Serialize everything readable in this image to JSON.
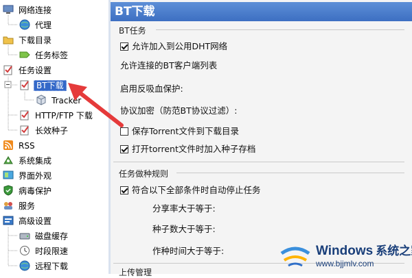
{
  "sidebar": {
    "items": [
      {
        "label": "网络连接",
        "icon": "network-icon"
      },
      {
        "label": "代理",
        "icon": "globe-icon"
      },
      {
        "label": "下载目录",
        "icon": "folder-icon"
      },
      {
        "label": "任务标签",
        "icon": "tag-icon"
      },
      {
        "label": "任务设置",
        "icon": "task-settings-icon"
      },
      {
        "label": "BT下载",
        "icon": "bt-icon",
        "selected": true
      },
      {
        "label": "Tracker",
        "icon": "cube-icon"
      },
      {
        "label": "HTTP/FTP 下载",
        "icon": "http-icon"
      },
      {
        "label": "长效种子",
        "icon": "seed-icon"
      },
      {
        "label": "RSS",
        "icon": "rss-icon"
      },
      {
        "label": "系统集成",
        "icon": "integration-icon"
      },
      {
        "label": "界面外观",
        "icon": "appearance-icon"
      },
      {
        "label": "病毒保护",
        "icon": "shield-icon"
      },
      {
        "label": "服务",
        "icon": "service-icon"
      },
      {
        "label": "高级设置",
        "icon": "advanced-icon"
      },
      {
        "label": "磁盘缓存",
        "icon": "disk-icon"
      },
      {
        "label": "时段限速",
        "icon": "speed-limit-icon"
      },
      {
        "label": "远程下载",
        "icon": "remote-icon"
      }
    ]
  },
  "panel": {
    "title": "BT下载",
    "group1": {
      "label": "BT任务",
      "options": [
        {
          "label": "允许加入到公用DHT网络",
          "checked": true
        },
        {
          "label": "允许连接的BT客户端列表",
          "checkbox": false
        },
        {
          "label": "启用反吸血保护:",
          "checkbox": false
        },
        {
          "label": "协议加密（防范BT协议过滤）:",
          "checkbox": false
        },
        {
          "label": "保存Torrent文件到下载目录",
          "checked": false
        },
        {
          "label": "打开torrent文件时加入种子存档",
          "checked": true
        }
      ]
    },
    "group2": {
      "label": "任务做种规则",
      "auto_stop": {
        "label": "符合以下全部条件时自动停止任务",
        "checked": true
      },
      "conditions": [
        "分享率大于等于:",
        "种子数大于等于:",
        "作种时间大于等于:"
      ]
    },
    "group3": {
      "label": "上传管理"
    }
  },
  "watermark": {
    "brand": "Windows",
    "brand_cn": "系统之家",
    "url": "www.bjjmlv.com"
  },
  "colors": {
    "title_bar": "#4a7dcc",
    "selected": "#3468c8",
    "arrow": "#e53a3a"
  }
}
